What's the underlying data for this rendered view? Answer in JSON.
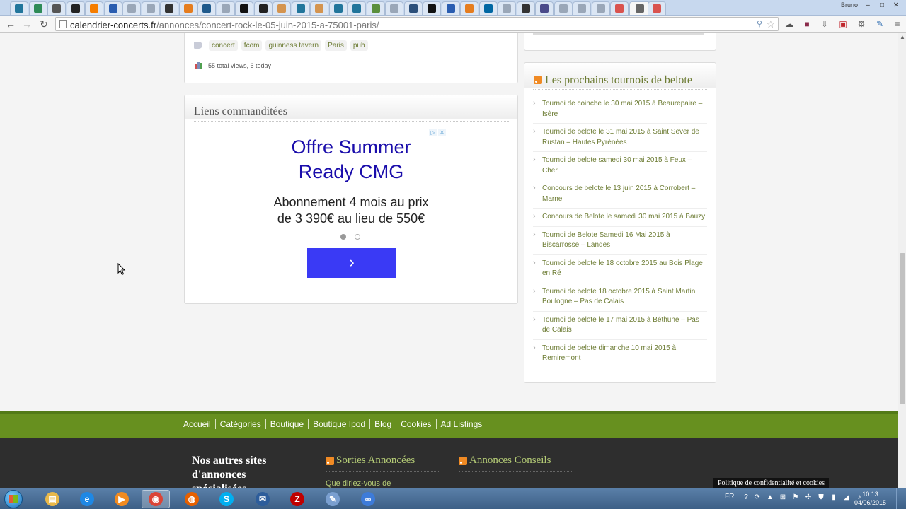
{
  "browser": {
    "tabs": [
      {
        "icon": "wordpress-icon",
        "color": "#21759b"
      },
      {
        "icon": "opera-icon",
        "color": "#2e8b57"
      },
      {
        "icon": "uh-icon",
        "color": "#555555"
      },
      {
        "icon": "man-icon",
        "color": "#222222"
      },
      {
        "icon": "blogger-icon",
        "color": "#f57d00"
      },
      {
        "icon": "lock-icon",
        "color": "#2a5db0"
      },
      {
        "icon": "page-icon",
        "color": "#9aa7b8"
      },
      {
        "icon": "page-icon",
        "color": "#9aa7b8"
      },
      {
        "icon": "m-icon",
        "color": "#333333"
      },
      {
        "icon": "fox-icon",
        "color": "#e57d1f"
      },
      {
        "icon": "flower-icon",
        "color": "#1f5a8c"
      },
      {
        "icon": "page-icon",
        "color": "#9aa7b8"
      },
      {
        "icon": "mp-icon",
        "color": "#111111"
      },
      {
        "icon": "x-icon",
        "color": "#222222"
      },
      {
        "icon": "hand-icon",
        "color": "#d4944f"
      },
      {
        "icon": "wordpress-icon",
        "color": "#21759b"
      },
      {
        "icon": "hand-icon",
        "color": "#d4944f"
      },
      {
        "icon": "wordpress-icon",
        "color": "#21759b"
      },
      {
        "icon": "wordpress-icon",
        "color": "#21759b"
      },
      {
        "icon": "bird-icon",
        "color": "#5a8f3c"
      },
      {
        "icon": "page-icon",
        "color": "#9aa7b8"
      },
      {
        "icon": "shield-icon",
        "color": "#2b4f7a"
      },
      {
        "icon": "box-icon",
        "color": "#111111"
      },
      {
        "icon": "chart-icon",
        "color": "#2a5db0"
      },
      {
        "icon": "bookmark-icon",
        "color": "#e57d1f"
      },
      {
        "icon": "trello-icon",
        "color": "#0067a3"
      },
      {
        "icon": "page-icon",
        "color": "#9aa7b8"
      },
      {
        "icon": "circle-icon",
        "color": "#333333"
      },
      {
        "icon": "circle-icon",
        "color": "#4a4a8a"
      },
      {
        "icon": "page-icon",
        "color": "#9aa7b8"
      },
      {
        "icon": "page-icon",
        "color": "#9aa7b8"
      },
      {
        "icon": "page-icon",
        "color": "#9aa7b8"
      },
      {
        "icon": "calendar-icon",
        "color": "#d9534f"
      },
      {
        "icon": "close-icon",
        "color": "#666666"
      },
      {
        "icon": "logo-icon",
        "color": "#d9534f"
      }
    ],
    "user": "Bruno",
    "url_host": "calendrier-concerts.fr",
    "url_path": "/annonces/concert-rock-le-05-juin-2015-a-75001-paris/"
  },
  "post": {
    "tags": [
      "concert",
      "fcom",
      "guinness tavern",
      "Paris",
      "pub"
    ],
    "views": "55 total views, 6 today"
  },
  "sponsored": {
    "title": "Liens commanditées",
    "ad_headline_1": "Offre Summer",
    "ad_headline_2": "Ready CMG",
    "ad_text_1": "Abonnement 4 mois au prix",
    "ad_text_2": "de 3 390€ au lieu de 550€",
    "ad_cta": "›"
  },
  "sidebar": {
    "title": "Les prochains tournois de belote",
    "items": [
      "Tournoi de coinche le 30 mai 2015 à Beaurepaire – Isère",
      "Tournoi de belote le 31 mai 2015 à Saint Sever de Rustan – Hautes Pyrénées",
      "Tournoi de belote samedi 30 mai 2015 à Feux – Cher",
      "Concours de belote le 13 juin 2015 à Corrobert – Marne",
      "Concours de Belote le samedi 30 mai 2015 à Bauzy",
      "Tournoi de Belote Samedi 16 Mai 2015 à Biscarrosse – Landes",
      "Tournoi de belote le 18 octobre 2015 au Bois Plage en Ré",
      "Tournoi de belote 18 octobre 2015 à Saint Martin Boulogne – Pas de Calais",
      "Tournoi de belote le 17 mai 2015 à Béthune – Pas de Calais",
      "Tournoi de belote dimanche 10 mai 2015 à Remiremont"
    ]
  },
  "footer": {
    "links": [
      "Accueil",
      "Catégories",
      "Boutique",
      "Boutique Ipod",
      "Blog",
      "Cookies",
      "Ad Listings"
    ],
    "col1_title_1": "Nos autres sites",
    "col1_title_2": "d'annonces",
    "col1_title_3": "spécialisées",
    "col2_title": "Sorties Annoncées",
    "col2_item": "Que diriez-vous de",
    "col3_title": "Annonces Conseils",
    "cookie_notice": "Politique de confidentialité et cookies"
  },
  "taskbar": {
    "apps": [
      {
        "name": "explorer",
        "glyph": "▤",
        "color": "#e8b84a"
      },
      {
        "name": "internet-explorer",
        "glyph": "e",
        "color": "#1e88e5"
      },
      {
        "name": "media-player",
        "glyph": "▶",
        "color": "#f28b20"
      },
      {
        "name": "chrome",
        "glyph": "◉",
        "color": "#db4437"
      },
      {
        "name": "firefox",
        "glyph": "◍",
        "color": "#e66000"
      },
      {
        "name": "skype",
        "glyph": "S",
        "color": "#00aff0"
      },
      {
        "name": "thunderbird",
        "glyph": "✉",
        "color": "#2d5d9b"
      },
      {
        "name": "filezilla",
        "glyph": "Z",
        "color": "#bf0000"
      },
      {
        "name": "paint",
        "glyph": "✎",
        "color": "#7a9fd0"
      },
      {
        "name": "app",
        "glyph": "∞",
        "color": "#3d7bd9"
      }
    ],
    "lang": "FR",
    "time": "10:13",
    "date": "04/06/2015"
  }
}
